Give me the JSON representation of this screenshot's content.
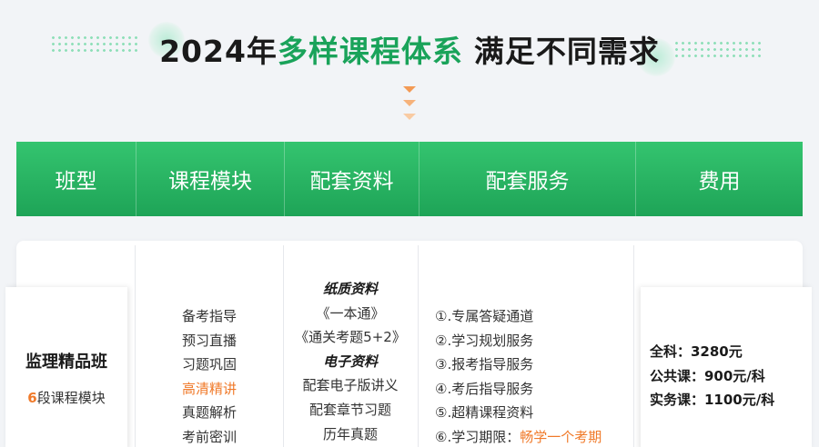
{
  "heading": {
    "part1": "2024年",
    "part2": "多样课程体系",
    "part3": "满足不同需求"
  },
  "colors": {
    "brand_green": "#1ea457",
    "accent_orange": "#f07a2a"
  },
  "table": {
    "headers": [
      "班型",
      "课程模块",
      "配套资料",
      "配套服务",
      "费用"
    ],
    "class_type": {
      "name": "监理精品班",
      "module_count": "6",
      "module_suffix": "段课程模块"
    },
    "modules": [
      "备考指导",
      "预习直播",
      "习题巩固",
      "高清精讲",
      "真题解析",
      "考前密训"
    ],
    "materials": {
      "paper_title": "纸质资料",
      "paper_items": [
        "《一本通》",
        "《通关考题5+2》"
      ],
      "electronic_title": "电子资料",
      "electronic_items": [
        "配套电子版讲义",
        "配套章节习题",
        "历年真题"
      ]
    },
    "services": {
      "items": [
        "①.专属答疑通道",
        "②.学习规划服务",
        "③.报考指导服务",
        "④.考后指导服务",
        "⑤.超精课程资料"
      ],
      "last_prefix": "⑥.学习期限：",
      "last_highlight": "畅学一个考期"
    },
    "fees": [
      "全科：3280元",
      "公共课：900元/科",
      "实务课：1100元/科"
    ]
  }
}
